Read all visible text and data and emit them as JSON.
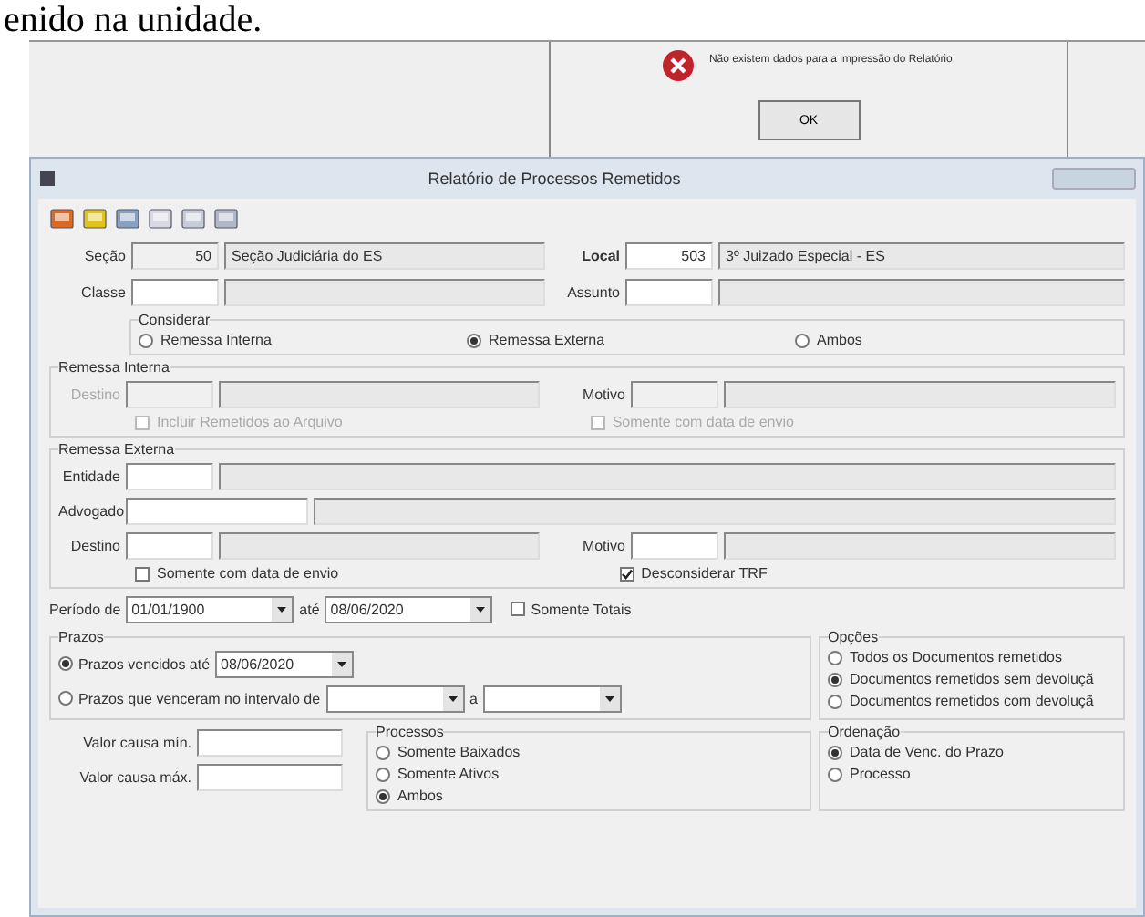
{
  "document_text": "enido na unidade.",
  "dialog": {
    "message": "Não existem dados para a impressão do Relatório.",
    "button": "OK"
  },
  "window": {
    "title": "Relatório de Processos Remetidos"
  },
  "secao": {
    "label": "Seção",
    "code": "50",
    "name": "Seção Judiciária do ES"
  },
  "local": {
    "label": "Local",
    "code": "503",
    "name": "3º Juizado Especial - ES"
  },
  "classe": {
    "label": "Classe"
  },
  "assunto": {
    "label": "Assunto"
  },
  "considerar": {
    "title": "Considerar",
    "options": [
      {
        "label": "Remessa Interna",
        "selected": false
      },
      {
        "label": "Remessa Externa",
        "selected": true
      },
      {
        "label": "Ambos",
        "selected": false
      }
    ]
  },
  "remessa_interna": {
    "title": "Remessa Interna",
    "disabled": true,
    "destino": "Destino",
    "motivo": "Motivo",
    "checks": [
      {
        "label": "Incluir Remetidos ao Arquivo",
        "checked": false
      },
      {
        "label": "Somente com data de envio",
        "checked": false
      }
    ]
  },
  "remessa_externa": {
    "title": "Remessa Externa",
    "entidade": "Entidade",
    "advogado": "Advogado",
    "destino": "Destino",
    "motivo": "Motivo",
    "checks": [
      {
        "label": "Somente com data de envio",
        "checked": false
      },
      {
        "label": "Desconsiderar TRF",
        "checked": true
      }
    ]
  },
  "periodo": {
    "label": "Período de",
    "from": "01/01/1900",
    "until": "até",
    "to": "08/06/2020",
    "totals": {
      "label": "Somente Totais",
      "checked": false
    }
  },
  "prazos": {
    "title": "Prazos",
    "options": [
      {
        "label": "Prazos vencidos até",
        "selected": true,
        "date": "08/06/2020"
      },
      {
        "label": "Prazos que venceram no intervalo de",
        "selected": false,
        "between": "a"
      }
    ]
  },
  "opcoes": {
    "title": "Opções",
    "options": [
      {
        "label": "Todos os Documentos remetidos",
        "selected": false
      },
      {
        "label": "Documentos remetidos sem devoluçã",
        "selected": true
      },
      {
        "label": "Documentos remetidos com devoluçã",
        "selected": false
      }
    ]
  },
  "valor": {
    "min": "Valor causa mín.",
    "max": "Valor causa máx."
  },
  "processos": {
    "title": "Processos",
    "options": [
      {
        "label": "Somente Baixados",
        "selected": false
      },
      {
        "label": "Somente Ativos",
        "selected": false
      },
      {
        "label": "Ambos",
        "selected": true
      }
    ]
  },
  "ordenacao": {
    "title": "Ordenação",
    "options": [
      {
        "label": "Data de Venc. do Prazo",
        "selected": true
      },
      {
        "label": "Processo",
        "selected": false
      }
    ]
  }
}
